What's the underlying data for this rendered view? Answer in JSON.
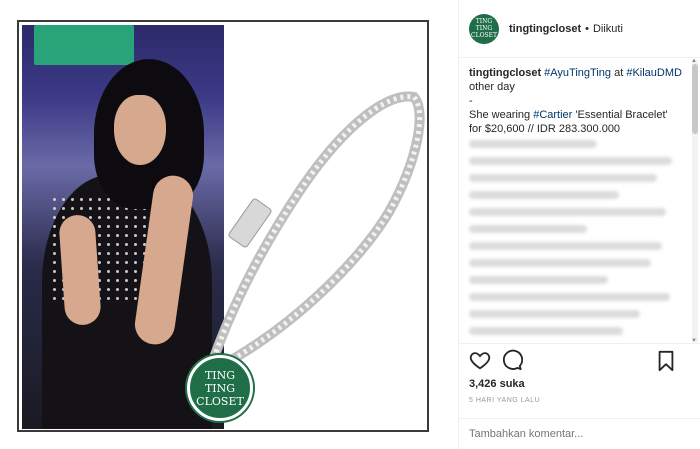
{
  "post": {
    "logo_line1": "TING TING",
    "logo_line2": "CLOSET"
  },
  "header": {
    "username": "tingtingcloset",
    "separator": "•",
    "follow_status": "Diikuti",
    "avatar_line1": "TING TING",
    "avatar_line2": "CLOSET"
  },
  "caption": {
    "username": "tingtingcloset",
    "tag1": "#AyuTingTing",
    "at_text": "at",
    "tag2": "#KilauDMD",
    "line2": "other day",
    "line3": "-",
    "line4_prefix": "She wearing",
    "tag3": "#Cartier",
    "line4_suffix": "'Essential Bracelet' for $20,600 // IDR 283.300.000"
  },
  "actions": {
    "like_icon": "heart-icon",
    "comment_icon": "comment-icon",
    "bookmark_icon": "bookmark-icon"
  },
  "likes": "3,426 suka",
  "timestamp": "5 HARI YANG LALU",
  "comment": {
    "placeholder": "Tambahkan komentar..."
  },
  "colors": {
    "brand_green": "#1f6e47",
    "hashtag_blue": "#003569",
    "border": "#efefef"
  }
}
